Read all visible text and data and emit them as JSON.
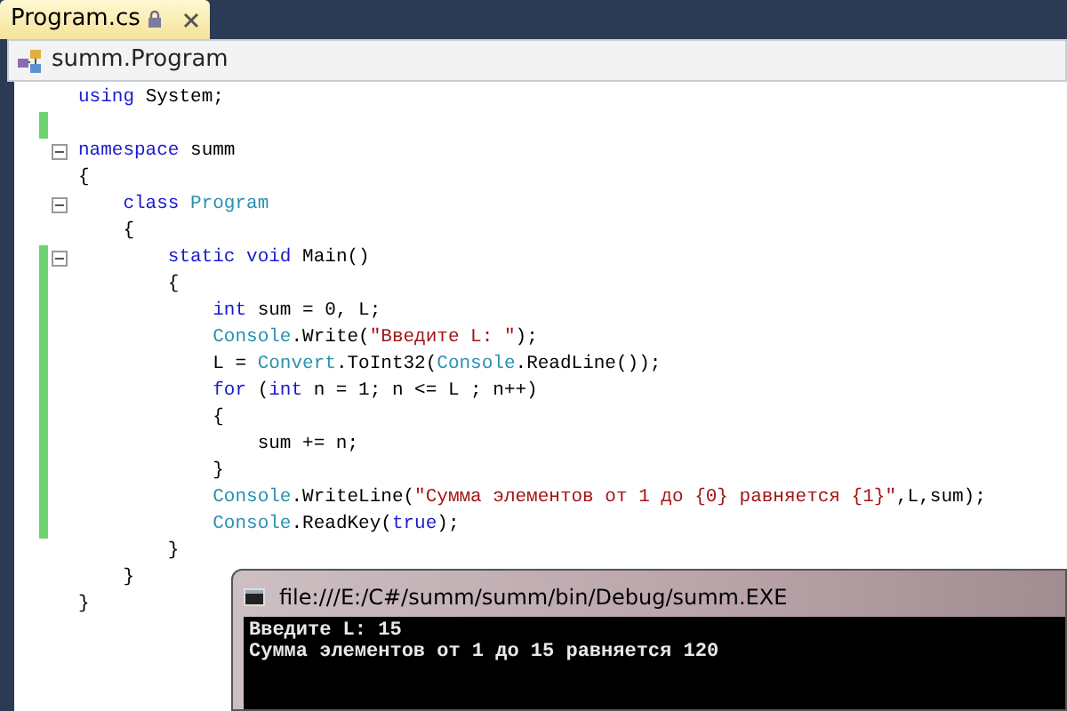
{
  "tabs": [
    {
      "label": "Program.cs",
      "selected": true,
      "locked": true
    }
  ],
  "navigation_bar": {
    "type_name": "summ.Program"
  },
  "editor": {
    "lines": [
      {
        "changed": false,
        "fold": false,
        "tokens": [
          {
            "kind": "keyword",
            "text": "using"
          },
          {
            "kind": "plain",
            "text": " System;"
          }
        ]
      },
      {
        "changed": true,
        "fold": false
      },
      {
        "changed": false,
        "fold": true,
        "tokens": [
          {
            "kind": "keyword",
            "text": "namespace"
          },
          {
            "kind": "plain",
            "text": " summ"
          }
        ]
      },
      {
        "changed": false,
        "fold": false,
        "tokens": [
          {
            "kind": "plain",
            "text": "{"
          }
        ]
      },
      {
        "changed": false,
        "fold": true,
        "tokens": [
          {
            "kind": "keyword",
            "text": "    class"
          },
          {
            "kind": "type",
            "text": " Program"
          }
        ]
      },
      {
        "changed": false,
        "fold": false,
        "tokens": [
          {
            "kind": "plain",
            "text": "    {"
          }
        ]
      },
      {
        "changed": true,
        "fold": true,
        "tokens": [
          {
            "kind": "keyword",
            "text": "        static"
          },
          {
            "kind": "keyword",
            "text": " void"
          },
          {
            "kind": "plain",
            "text": " Main()"
          }
        ]
      },
      {
        "changed": true,
        "fold": false,
        "tokens": [
          {
            "kind": "plain",
            "text": "        {"
          }
        ]
      },
      {
        "changed": true,
        "fold": false,
        "tokens": [
          {
            "kind": "keyword",
            "text": "            int"
          },
          {
            "kind": "plain",
            "text": " sum = 0, L;"
          }
        ]
      },
      {
        "changed": true,
        "fold": false,
        "tokens": [
          {
            "kind": "type",
            "text": "            Console"
          },
          {
            "kind": "plain",
            "text": ".Write("
          },
          {
            "kind": "string",
            "text": "\"Введите L: \""
          },
          {
            "kind": "plain",
            "text": ");"
          }
        ]
      },
      {
        "changed": true,
        "fold": false,
        "tokens": [
          {
            "kind": "plain",
            "text": "            L = "
          },
          {
            "kind": "type",
            "text": "Convert"
          },
          {
            "kind": "plain",
            "text": ".ToInt32("
          },
          {
            "kind": "type",
            "text": "Console"
          },
          {
            "kind": "plain",
            "text": ".ReadLine());"
          }
        ]
      },
      {
        "changed": true,
        "fold": false,
        "tokens": [
          {
            "kind": "keyword",
            "text": "            for"
          },
          {
            "kind": "plain",
            "text": " ("
          },
          {
            "kind": "keyword",
            "text": "int"
          },
          {
            "kind": "plain",
            "text": " n = 1; n <= L ; n++)"
          }
        ]
      },
      {
        "changed": true,
        "fold": false,
        "tokens": [
          {
            "kind": "plain",
            "text": "            {"
          }
        ]
      },
      {
        "changed": true,
        "fold": false,
        "tokens": [
          {
            "kind": "plain",
            "text": "                sum += n;"
          }
        ]
      },
      {
        "changed": true,
        "fold": false,
        "tokens": [
          {
            "kind": "plain",
            "text": "            }"
          }
        ]
      },
      {
        "changed": true,
        "fold": false,
        "tokens": [
          {
            "kind": "type",
            "text": "            Console"
          },
          {
            "kind": "plain",
            "text": ".WriteLine("
          },
          {
            "kind": "string",
            "text": "\"Сумма элементов от 1 до {0} равняется {1}\""
          },
          {
            "kind": "plain",
            "text": ",L,sum);"
          }
        ]
      },
      {
        "changed": true,
        "fold": false,
        "tokens": [
          {
            "kind": "type",
            "text": "            Console"
          },
          {
            "kind": "plain",
            "text": ".ReadKey("
          },
          {
            "kind": "keyword",
            "text": "true"
          },
          {
            "kind": "plain",
            "text": ");"
          }
        ]
      },
      {
        "changed": false,
        "fold": false,
        "tokens": [
          {
            "kind": "plain",
            "text": "        }"
          }
        ]
      },
      {
        "changed": false,
        "fold": false,
        "tokens": [
          {
            "kind": "plain",
            "text": "    }"
          }
        ]
      },
      {
        "changed": false,
        "fold": false,
        "tokens": [
          {
            "kind": "plain",
            "text": "}"
          }
        ]
      }
    ]
  },
  "console_window": {
    "title": "file:///E:/C#/summ/summ/bin/Debug/summ.EXE",
    "output": [
      "Введите L: 15",
      "Сумма элементов от 1 до 15 равняется 120"
    ]
  }
}
